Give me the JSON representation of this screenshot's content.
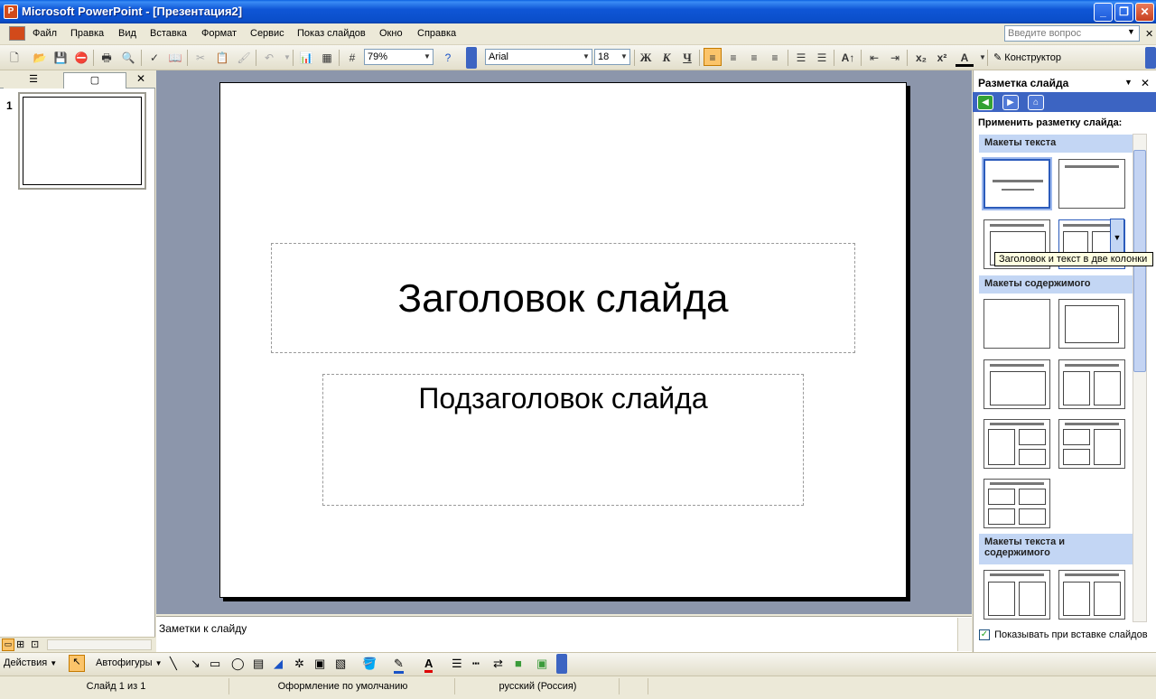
{
  "window": {
    "title": "Microsoft PowerPoint - [Презентация2]",
    "app_icon_letter": "P"
  },
  "menu": {
    "items": [
      "Файл",
      "Правка",
      "Вид",
      "Вставка",
      "Формат",
      "Сервис",
      "Показ слайдов",
      "Окно",
      "Справка"
    ],
    "ask_placeholder": "Введите вопрос"
  },
  "toolbar": {
    "zoom": "79%",
    "font_name": "Arial",
    "font_size": "18",
    "bold_label": "Ж",
    "italic_label": "К",
    "underline_label": "Ч",
    "designer_label": "Конструктор"
  },
  "slides_panel": {
    "slide_number": "1"
  },
  "slide": {
    "title_placeholder": "Заголовок слайда",
    "subtitle_placeholder": "Подзаголовок слайда"
  },
  "notes": {
    "placeholder": "Заметки к слайду"
  },
  "task_pane": {
    "title": "Разметка слайда",
    "apply_label": "Применить разметку слайда:",
    "sections": [
      "Макеты текста",
      "Макеты содержимого",
      "Макеты текста и содержимого"
    ],
    "tooltip": "Заголовок и текст в две колонки",
    "show_on_insert": "Показывать при вставке слайдов"
  },
  "drawing_toolbar": {
    "actions_label": "Действия",
    "autoshapes_label": "Автофигуры"
  },
  "status": {
    "slide_of": "Слайд 1 из 1",
    "design": "Оформление по умолчанию",
    "language": "русский (Россия)"
  }
}
